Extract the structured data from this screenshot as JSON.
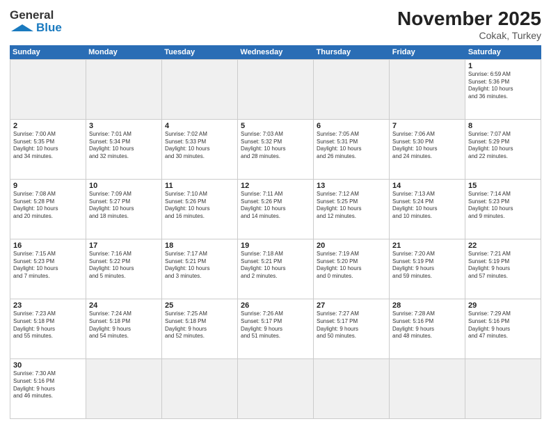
{
  "header": {
    "logo_general": "General",
    "logo_blue": "Blue",
    "month_title": "November 2025",
    "location": "Cokak, Turkey"
  },
  "weekdays": [
    "Sunday",
    "Monday",
    "Tuesday",
    "Wednesday",
    "Thursday",
    "Friday",
    "Saturday"
  ],
  "weeks": [
    [
      {
        "day": "",
        "info": "",
        "empty": true
      },
      {
        "day": "",
        "info": "",
        "empty": true
      },
      {
        "day": "",
        "info": "",
        "empty": true
      },
      {
        "day": "",
        "info": "",
        "empty": true
      },
      {
        "day": "",
        "info": "",
        "empty": true
      },
      {
        "day": "",
        "info": "",
        "empty": true
      },
      {
        "day": "1",
        "info": "Sunrise: 6:59 AM\nSunset: 5:36 PM\nDaylight: 10 hours\nand 36 minutes."
      }
    ],
    [
      {
        "day": "2",
        "info": "Sunrise: 7:00 AM\nSunset: 5:35 PM\nDaylight: 10 hours\nand 34 minutes."
      },
      {
        "day": "3",
        "info": "Sunrise: 7:01 AM\nSunset: 5:34 PM\nDaylight: 10 hours\nand 32 minutes."
      },
      {
        "day": "4",
        "info": "Sunrise: 7:02 AM\nSunset: 5:33 PM\nDaylight: 10 hours\nand 30 minutes."
      },
      {
        "day": "5",
        "info": "Sunrise: 7:03 AM\nSunset: 5:32 PM\nDaylight: 10 hours\nand 28 minutes."
      },
      {
        "day": "6",
        "info": "Sunrise: 7:05 AM\nSunset: 5:31 PM\nDaylight: 10 hours\nand 26 minutes."
      },
      {
        "day": "7",
        "info": "Sunrise: 7:06 AM\nSunset: 5:30 PM\nDaylight: 10 hours\nand 24 minutes."
      },
      {
        "day": "8",
        "info": "Sunrise: 7:07 AM\nSunset: 5:29 PM\nDaylight: 10 hours\nand 22 minutes."
      }
    ],
    [
      {
        "day": "9",
        "info": "Sunrise: 7:08 AM\nSunset: 5:28 PM\nDaylight: 10 hours\nand 20 minutes."
      },
      {
        "day": "10",
        "info": "Sunrise: 7:09 AM\nSunset: 5:27 PM\nDaylight: 10 hours\nand 18 minutes."
      },
      {
        "day": "11",
        "info": "Sunrise: 7:10 AM\nSunset: 5:26 PM\nDaylight: 10 hours\nand 16 minutes."
      },
      {
        "day": "12",
        "info": "Sunrise: 7:11 AM\nSunset: 5:26 PM\nDaylight: 10 hours\nand 14 minutes."
      },
      {
        "day": "13",
        "info": "Sunrise: 7:12 AM\nSunset: 5:25 PM\nDaylight: 10 hours\nand 12 minutes."
      },
      {
        "day": "14",
        "info": "Sunrise: 7:13 AM\nSunset: 5:24 PM\nDaylight: 10 hours\nand 10 minutes."
      },
      {
        "day": "15",
        "info": "Sunrise: 7:14 AM\nSunset: 5:23 PM\nDaylight: 10 hours\nand 9 minutes."
      }
    ],
    [
      {
        "day": "16",
        "info": "Sunrise: 7:15 AM\nSunset: 5:23 PM\nDaylight: 10 hours\nand 7 minutes."
      },
      {
        "day": "17",
        "info": "Sunrise: 7:16 AM\nSunset: 5:22 PM\nDaylight: 10 hours\nand 5 minutes."
      },
      {
        "day": "18",
        "info": "Sunrise: 7:17 AM\nSunset: 5:21 PM\nDaylight: 10 hours\nand 3 minutes."
      },
      {
        "day": "19",
        "info": "Sunrise: 7:18 AM\nSunset: 5:21 PM\nDaylight: 10 hours\nand 2 minutes."
      },
      {
        "day": "20",
        "info": "Sunrise: 7:19 AM\nSunset: 5:20 PM\nDaylight: 10 hours\nand 0 minutes."
      },
      {
        "day": "21",
        "info": "Sunrise: 7:20 AM\nSunset: 5:19 PM\nDaylight: 9 hours\nand 59 minutes."
      },
      {
        "day": "22",
        "info": "Sunrise: 7:21 AM\nSunset: 5:19 PM\nDaylight: 9 hours\nand 57 minutes."
      }
    ],
    [
      {
        "day": "23",
        "info": "Sunrise: 7:23 AM\nSunset: 5:18 PM\nDaylight: 9 hours\nand 55 minutes."
      },
      {
        "day": "24",
        "info": "Sunrise: 7:24 AM\nSunset: 5:18 PM\nDaylight: 9 hours\nand 54 minutes."
      },
      {
        "day": "25",
        "info": "Sunrise: 7:25 AM\nSunset: 5:18 PM\nDaylight: 9 hours\nand 52 minutes."
      },
      {
        "day": "26",
        "info": "Sunrise: 7:26 AM\nSunset: 5:17 PM\nDaylight: 9 hours\nand 51 minutes."
      },
      {
        "day": "27",
        "info": "Sunrise: 7:27 AM\nSunset: 5:17 PM\nDaylight: 9 hours\nand 50 minutes."
      },
      {
        "day": "28",
        "info": "Sunrise: 7:28 AM\nSunset: 5:16 PM\nDaylight: 9 hours\nand 48 minutes."
      },
      {
        "day": "29",
        "info": "Sunrise: 7:29 AM\nSunset: 5:16 PM\nDaylight: 9 hours\nand 47 minutes."
      }
    ],
    [
      {
        "day": "30",
        "info": "Sunrise: 7:30 AM\nSunset: 5:16 PM\nDaylight: 9 hours\nand 46 minutes."
      },
      {
        "day": "",
        "info": "",
        "empty": true
      },
      {
        "day": "",
        "info": "",
        "empty": true
      },
      {
        "day": "",
        "info": "",
        "empty": true
      },
      {
        "day": "",
        "info": "",
        "empty": true
      },
      {
        "day": "",
        "info": "",
        "empty": true
      },
      {
        "day": "",
        "info": "",
        "empty": true
      }
    ]
  ]
}
